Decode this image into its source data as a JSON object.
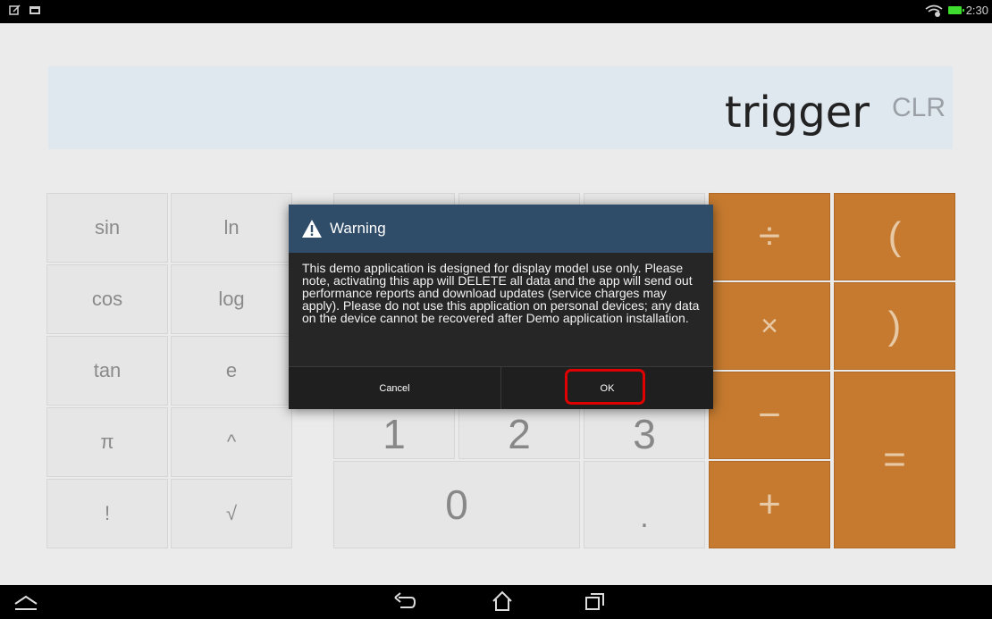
{
  "status_bar": {
    "time": "2:30",
    "icons": [
      "notification-icon",
      "image-icon",
      "wifi-icon",
      "battery-icon"
    ]
  },
  "display": {
    "expression": "trigger",
    "clear_label": "CLR"
  },
  "keypad": {
    "function_keys": [
      "sin",
      "ln",
      "cos",
      "log",
      "tan",
      "e",
      "π",
      "^",
      "!",
      "√"
    ],
    "digit_keys": [
      "1",
      "2",
      "3",
      "0",
      "."
    ],
    "operator_keys": [
      "÷",
      "(",
      "×",
      ")",
      "−",
      "=",
      "+"
    ]
  },
  "dialog": {
    "title": "Warning",
    "body": "This demo application is designed for display model use only. Please note, activating this app will DELETE all data and the app will send out performance reports and download updates (service charges may apply). Please do not use this application on personal devices; any data on the device cannot be recovered after Demo application installation.",
    "cancel_label": "Cancel",
    "ok_label": "OK"
  },
  "colors": {
    "dialog_header": "#2f4c69",
    "operator_key": "#c57a2f",
    "highlight": "#e00000"
  }
}
